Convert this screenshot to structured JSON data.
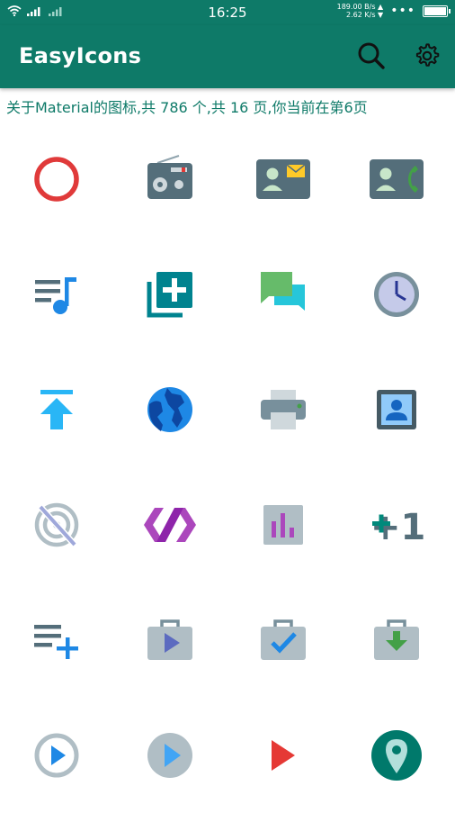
{
  "status_bar": {
    "time": "16:25",
    "net_up": "189.00 B/s ▲",
    "net_down": "2.62 K/s ▼",
    "more": "•••"
  },
  "app_bar": {
    "title": "EasyIcons",
    "search_icon": "search-icon",
    "settings_icon": "gear-icon"
  },
  "info_text": "关于Material的图标,共 786 个,共 16 页,你当前在第6页",
  "icons": [
    "circle-ring-icon",
    "radio-icon",
    "contact-mail-icon",
    "contact-phone-icon",
    "queue-music-icon",
    "library-add-icon",
    "forum-icon",
    "clock-icon",
    "publish-icon",
    "public-globe-icon",
    "print-icon",
    "portrait-icon",
    "portable-wifi-off-icon",
    "polymer-icon",
    "poll-icon",
    "plus-one-icon",
    "playlist-add-icon",
    "play-shopping-bag-icon",
    "check-shopping-bag-icon",
    "download-bag-icon",
    "play-circle-outline-icon",
    "play-circle-filled-icon",
    "play-arrow-icon",
    "place-icon"
  ],
  "plus_one_text": "+1",
  "colors": {
    "primary": "#0e7a68",
    "accent_red": "#e53935",
    "slate": "#546e7a"
  }
}
